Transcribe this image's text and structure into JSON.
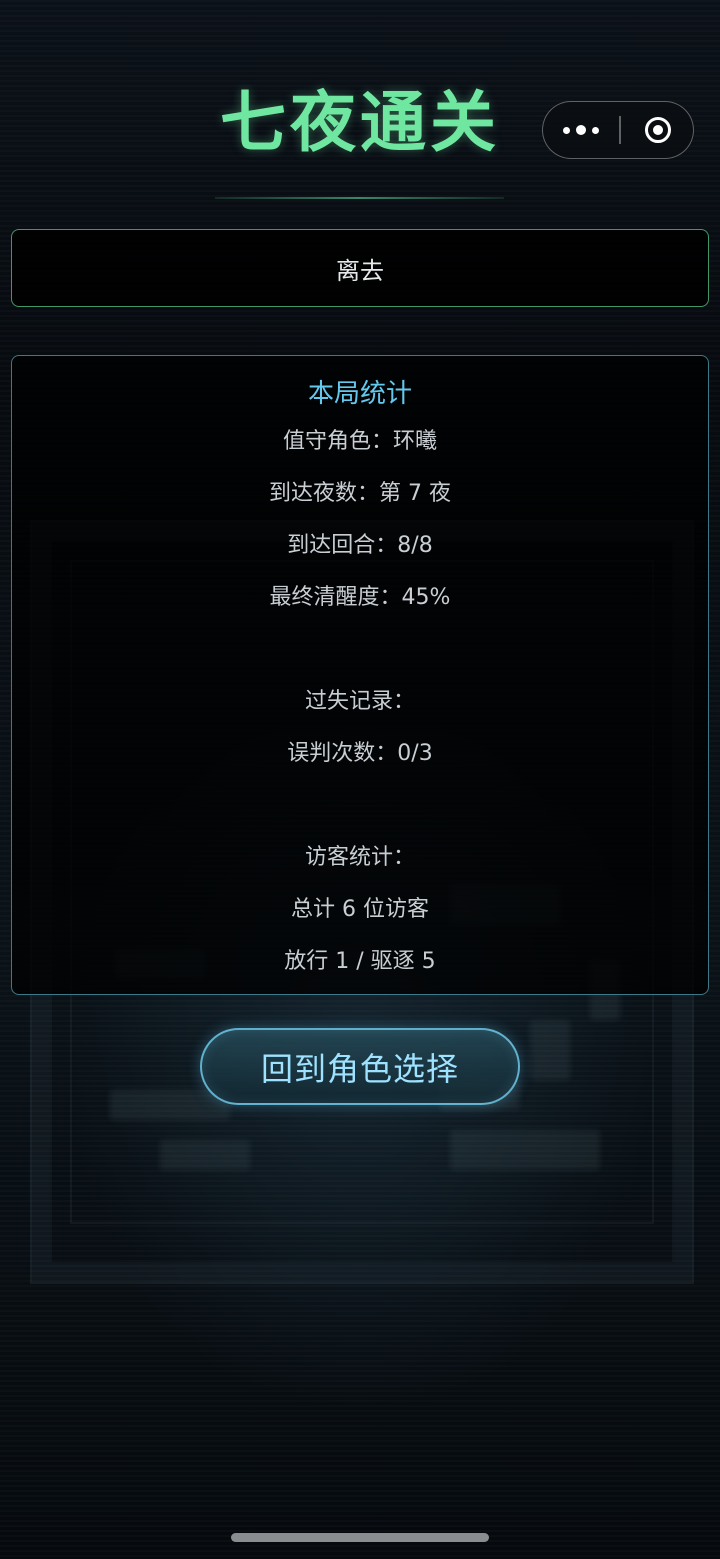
{
  "header": {
    "title": "七夜通关"
  },
  "capsule": {
    "more_icon": "more-dots-icon",
    "close_icon": "target-ring-icon"
  },
  "status": {
    "text": "离去"
  },
  "stats": {
    "heading": "本局统计",
    "lines": [
      "值守角色：环曦",
      "到达夜数：第 7 夜",
      "到达回合：8/8",
      "最终清醒度：45%",
      "过失记录：",
      "误判次数：0/3",
      "访客统计：",
      "总计 6 位访客",
      "放行 1 / 驱逐 5"
    ]
  },
  "actions": {
    "return_label": "回到角色选择"
  },
  "colors": {
    "title": "#6fe7a0",
    "heading": "#63c8ec",
    "button_text": "#9fe2ff",
    "background": "#05080b"
  }
}
